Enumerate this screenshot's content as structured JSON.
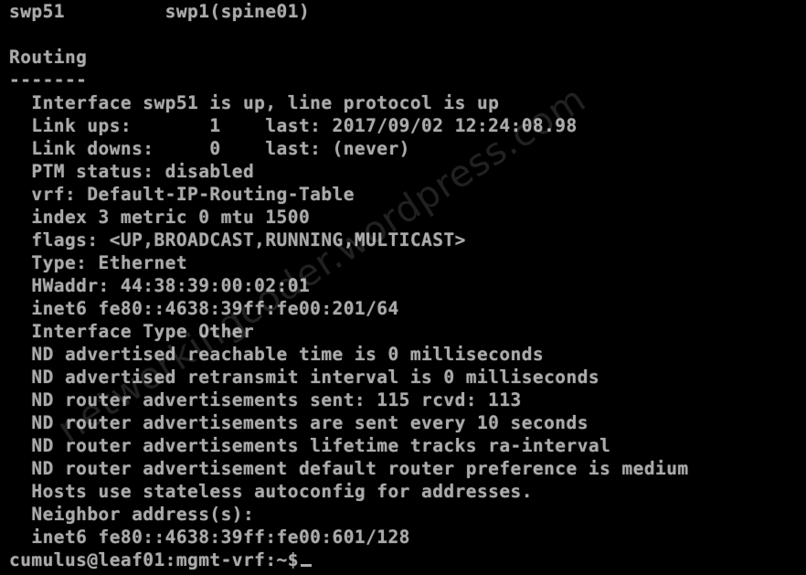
{
  "terminal": {
    "lines": [
      "swp51         swp1(spine01)",
      "",
      "Routing",
      "-------",
      "  Interface swp51 is up, line protocol is up",
      "  Link ups:       1    last: 2017/09/02 12:24:08.98",
      "  Link downs:     0    last: (never)",
      "  PTM status: disabled",
      "  vrf: Default-IP-Routing-Table",
      "  index 3 metric 0 mtu 1500",
      "  flags: <UP,BROADCAST,RUNNING,MULTICAST>",
      "  Type: Ethernet",
      "  HWaddr: 44:38:39:00:02:01",
      "  inet6 fe80::4638:39ff:fe00:201/64",
      "  Interface Type Other",
      "  ND advertised reachable time is 0 milliseconds",
      "  ND advertised retransmit interval is 0 milliseconds",
      "  ND router advertisements sent: 115 rcvd: 113",
      "  ND router advertisements are sent every 10 seconds",
      "  ND router advertisements lifetime tracks ra-interval",
      "  ND router advertisement default router preference is medium",
      "  Hosts use stateless autoconfig for addresses.",
      "  Neighbor address(s):",
      "  inet6 fe80::4638:39ff:fe00:601/128"
    ],
    "prompt": "cumulus@leaf01:mgmt-vrf:~$"
  },
  "watermark": "networkingcoder.wordpress.com",
  "colors": {
    "background": "#000000",
    "foreground": "#aaaaaa"
  }
}
